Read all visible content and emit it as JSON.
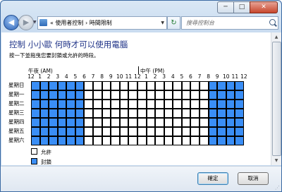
{
  "window": {
    "caption_buttons": {
      "minimize": "─",
      "maximize": "□",
      "close": "✕"
    }
  },
  "navbar": {
    "breadcrumbs": "« 使用者控制 › 時間限制",
    "search_placeholder": "搜尋控制台"
  },
  "main": {
    "heading": "控制 小小歐 何時才可以使用電腦",
    "instruction": "按一下並拖曳您要封鎖或允許的時段。",
    "am_label": "午夜 (AM)",
    "pm_label": "中午 (PM)",
    "hour_labels": [
      "12",
      "1",
      "2",
      "3",
      "4",
      "5",
      "6",
      "7",
      "8",
      "9",
      "10",
      "11",
      "12",
      "1",
      "2",
      "3",
      "4",
      "5",
      "6",
      "7",
      "8",
      "9",
      "10",
      "11",
      "12"
    ],
    "days": [
      "星期日",
      "星期一",
      "星期二",
      "星期三",
      "星期四",
      "星期五",
      "星期六"
    ],
    "schedule": {
      "blocked_hours_each_day": [
        0,
        1,
        2,
        3,
        4,
        5,
        20,
        21,
        22,
        23
      ]
    }
  },
  "legend": {
    "allowed": "允許",
    "blocked": "封鎖",
    "allowed_color": "#ffffff",
    "blocked_color": "#3a8ef6"
  },
  "footer": {
    "ok_label": "確定",
    "cancel_label": "取消"
  }
}
